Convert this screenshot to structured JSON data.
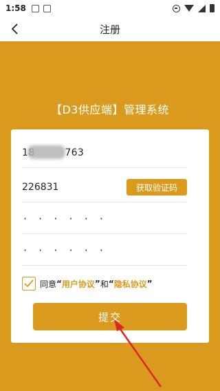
{
  "status_bar": {
    "time": "1:58"
  },
  "nav": {
    "title": "注册"
  },
  "system_title": "【D3供应端】管理系统",
  "form": {
    "phone_prefix": "18",
    "phone_suffix": "763",
    "code_value": "226831",
    "code_button_label": "获取验证码",
    "password_dots": "· · · · · ·",
    "confirm_password_dots": "· · · · · ·",
    "agree_prefix": "同意",
    "quote_open": "“",
    "quote_close": "”",
    "user_agreement": "用户协议",
    "and_text": "和",
    "privacy_agreement": "隐私协议",
    "agree_checked": true,
    "submit_label": "提交"
  },
  "colors": {
    "accent": "#d99a1e",
    "card": "#ffffff",
    "arrow": "#e02424"
  }
}
